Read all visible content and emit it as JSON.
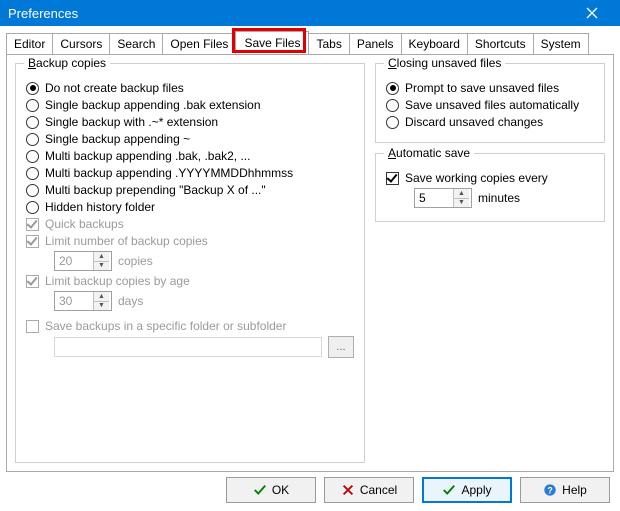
{
  "window": {
    "title": "Preferences"
  },
  "tabs": {
    "items": [
      "Editor",
      "Cursors",
      "Search",
      "Open Files",
      "Save Files",
      "Tabs",
      "Panels",
      "Keyboard",
      "Shortcuts",
      "System"
    ],
    "active_index": 4,
    "highlight_index": 4
  },
  "backup_group": {
    "legend_prefix": "B",
    "legend_rest": "ackup copies",
    "radios": [
      "Do not create backup files",
      "Single backup appending .bak extension",
      "Single backup with .~* extension",
      "Single backup appending ~",
      "Multi backup appending .bak, .bak2, ...",
      "Multi backup appending .YYYYMMDDhhmmss",
      "Multi backup prepending \"Backup X of ...\"",
      "Hidden history folder"
    ],
    "selected_radio": 0,
    "quick_backups": {
      "label": "Quick backups",
      "checked": true,
      "disabled": true
    },
    "limit_number": {
      "label": "Limit number of backup copies",
      "checked": true,
      "disabled": true,
      "value": "20",
      "unit": "copies"
    },
    "limit_age": {
      "label": "Limit backup copies by age",
      "checked": true,
      "disabled": true,
      "value": "30",
      "unit": "days"
    },
    "save_in_folder": {
      "label": "Save backups in a specific folder or subfolder",
      "checked": false,
      "disabled": true,
      "path": ""
    },
    "browse_label": "..."
  },
  "closing_group": {
    "legend_prefix": "C",
    "legend_rest": "losing unsaved files",
    "radios": [
      "Prompt to save unsaved files",
      "Save unsaved files automatically",
      "Discard unsaved changes"
    ],
    "selected_radio": 0
  },
  "autosave_group": {
    "legend_prefix": "A",
    "legend_rest": "utomatic save",
    "checkbox_label": "Save working copies every",
    "checked": true,
    "value": "5",
    "unit": "minutes"
  },
  "buttons": {
    "ok": "OK",
    "cancel": "Cancel",
    "apply": "Apply",
    "help": "Help"
  }
}
